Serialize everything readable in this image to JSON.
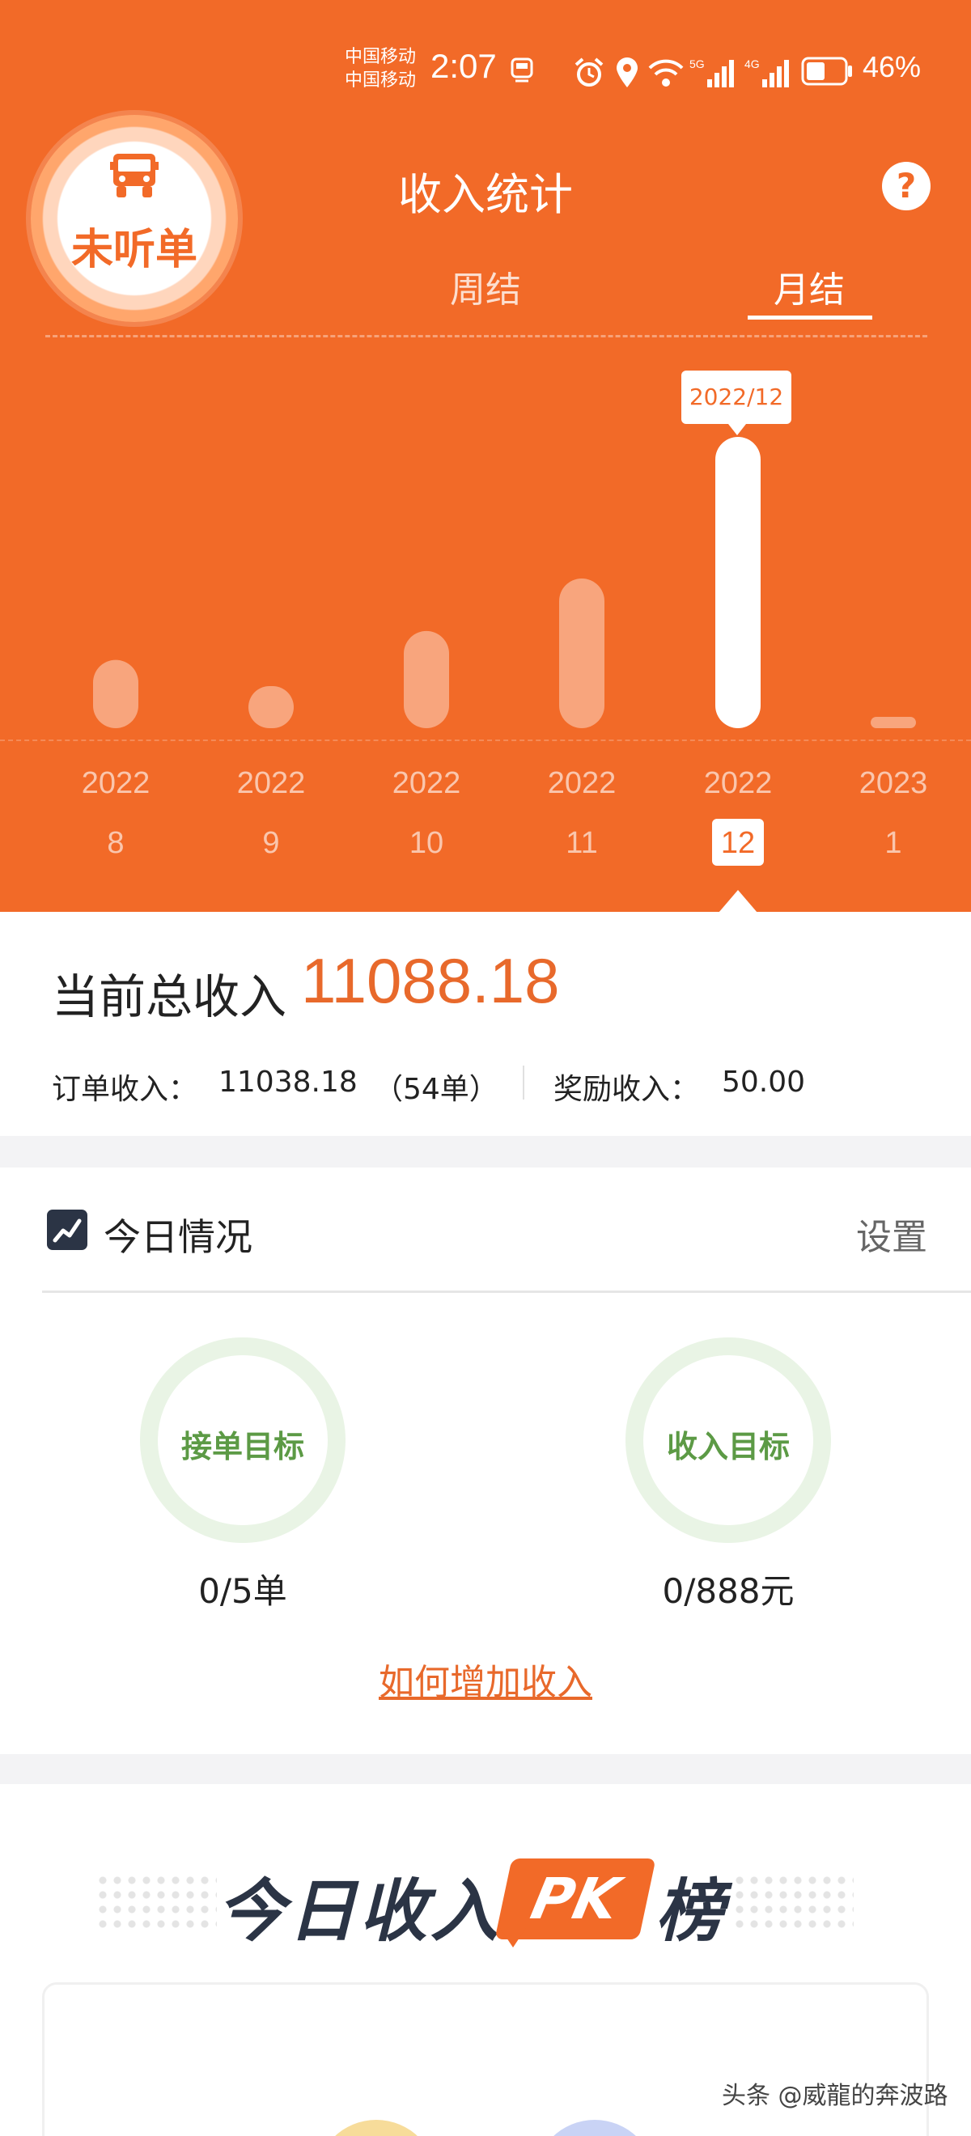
{
  "status_bar": {
    "carrier_1": "中国移动",
    "carrier_2": "中国移动",
    "time": "2:07",
    "battery": "46%",
    "icons": [
      "train-icon",
      "alarm-icon",
      "location-icon",
      "wifi-icon",
      "signal-5g-icon",
      "signal-4g-icon",
      "battery-icon"
    ]
  },
  "header": {
    "listen_status": "未听单",
    "title": "收入统计",
    "help_icon": "question-icon",
    "tabs": [
      {
        "label": "周结",
        "active": false
      },
      {
        "label": "月结",
        "active": true
      }
    ]
  },
  "chart_data": {
    "type": "bar",
    "categories": [
      {
        "year": "2022",
        "month": "8"
      },
      {
        "year": "2022",
        "month": "9"
      },
      {
        "year": "2022",
        "month": "10"
      },
      {
        "year": "2022",
        "month": "11"
      },
      {
        "year": "2022",
        "month": "12"
      },
      {
        "year": "2023",
        "month": "1"
      }
    ],
    "values": [
      2600,
      1600,
      3700,
      5700,
      11088.18,
      0
    ],
    "selected_index": 4,
    "tooltip": "2022/12",
    "ylim": [
      0,
      11088.18
    ],
    "colors": {
      "bar": "#f8a57d",
      "selected": "#ffffff",
      "background": "#f26a28"
    }
  },
  "income": {
    "total_label": "当前总收入",
    "total_value": "11088.18",
    "order_label": "订单收入：",
    "order_value": "11038.18",
    "order_count": "（54单）",
    "bonus_label": "奖励收入：",
    "bonus_value": "50.00"
  },
  "today": {
    "title": "今日情况",
    "settings": "设置",
    "goals": [
      {
        "label": "接单目标",
        "value": "0/5单"
      },
      {
        "label": "收入目标",
        "value": "0/888元"
      }
    ],
    "link": "如何增加收入"
  },
  "pk": {
    "title_part1": "今日收入",
    "badge": "PK",
    "title_part2": "榜"
  },
  "watermark": "头条 @威龍的奔波路",
  "colors": {
    "brand": "#f26a28",
    "accent_text": "#e8692b",
    "goal_green": "#5c9a45"
  }
}
